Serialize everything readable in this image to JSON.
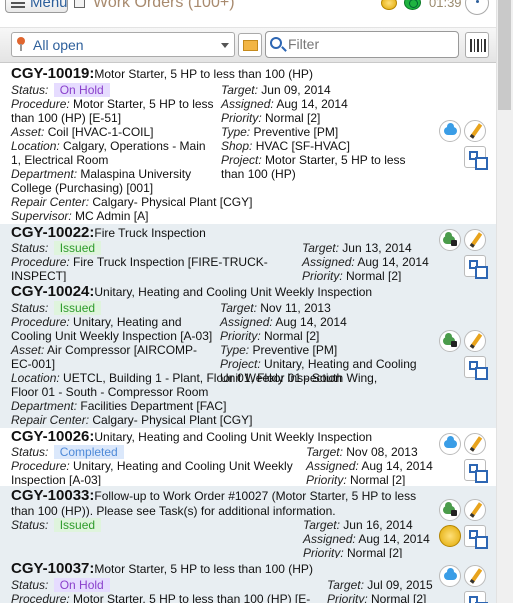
{
  "header": {
    "menu_label": "Menu",
    "title": "Work Orders (100+)",
    "time": "01:39"
  },
  "filter": {
    "view": "All open",
    "search_placeholder": "Filter"
  },
  "labels": {
    "status": "Status:",
    "procedure": "Procedure:",
    "asset": "Asset:",
    "location": "Location:",
    "department": "Department:",
    "repair_center": "Repair Center:",
    "supervisor": "Supervisor:",
    "target": "Target:",
    "assigned": "Assigned:",
    "priority": "Priority:",
    "type": "Type:",
    "shop": "Shop:",
    "project": "Project:"
  },
  "work_orders": [
    {
      "id": "CGY-10019:",
      "desc": "Motor Starter, 5 HP to less than 100 (HP)",
      "status": "On Hold",
      "status_color": "#8a3fcb",
      "procedure": "Motor Starter, 5 HP to less than 100 (HP) [E-51]",
      "asset": "Coil [HVAC-1-COIL]",
      "location": "Calgary, Operations - Main 1, Electrical Room",
      "department": "Malaspina University College (Purchasing) [001]",
      "repair_center": "Calgary- Physical Plant [CGY]",
      "supervisor": "MC Admin [A]",
      "target": "Jun 09, 2014",
      "assigned": "Aug 14, 2014",
      "priority": "Normal [2]",
      "type": "Preventive [PM]",
      "shop": "HVAC [SF-HVAC]",
      "project": "Motor Starter, 5 HP to less than 100 (HP)"
    },
    {
      "id": "CGY-10022:",
      "desc": "Fire Truck Inspection",
      "status": "Issued",
      "status_color": "#2f9b2b",
      "procedure": "Fire Truck Inspection [FIRE-TRUCK-INSPECT]",
      "target": "Jun 13, 2014",
      "assigned": "Aug 14, 2014",
      "priority": "Normal [2]"
    },
    {
      "id": "CGY-10024:",
      "desc": "Unitary, Heating and Cooling Unit Weekly Inspection",
      "status": "Issued",
      "status_color": "#2f9b2b",
      "procedure": "Unitary, Heating and Cooling Unit Weekly Inspection [A-03]",
      "asset": "Air Compressor [AIRCOMP-EC-001]",
      "location": "UETCL, Building 1 - Plant, Floor 01, Floor 01 - South Wing, Floor 01 - South - Compressor Room",
      "department": "Facilities Department [FAC]",
      "repair_center": "Calgary- Physical Plant [CGY]",
      "target": "Nov 11, 2013",
      "assigned": "Aug 14, 2014",
      "priority": "Normal [2]",
      "type": "Preventive [PM]",
      "project": "Unitary, Heating and Cooling Unit Weekly Inspection"
    },
    {
      "id": "CGY-10026:",
      "desc": "Unitary, Heating and Cooling Unit Weekly Inspection",
      "status": "Completed",
      "status_color": "#4f8ad8",
      "procedure": "Unitary, Heating and Cooling Unit Weekly Inspection [A-03]",
      "target": "Nov 08, 2013",
      "assigned": "Aug 14, 2014",
      "priority": "Normal [2]"
    },
    {
      "id": "CGY-10033:",
      "desc": "Follow-up to Work Order #10027 (Motor Starter, 5 HP to less than 100 (HP)). Please see Task(s) for additional information.",
      "status": "Issued",
      "status_color": "#2f9b2b",
      "target": "Jun 16, 2014",
      "assigned": "Aug 14, 2014",
      "priority": "Normal [2]"
    },
    {
      "id": "CGY-10037:",
      "desc": "Motor Starter, 5 HP to less than 100 (HP)",
      "status": "On Hold",
      "status_color": "#8a3fcb",
      "procedure": "Motor Starter, 5 HP to less than 100 (HP) [E-",
      "target": "Jul 09, 2015",
      "priority": "Normal [2]"
    }
  ]
}
